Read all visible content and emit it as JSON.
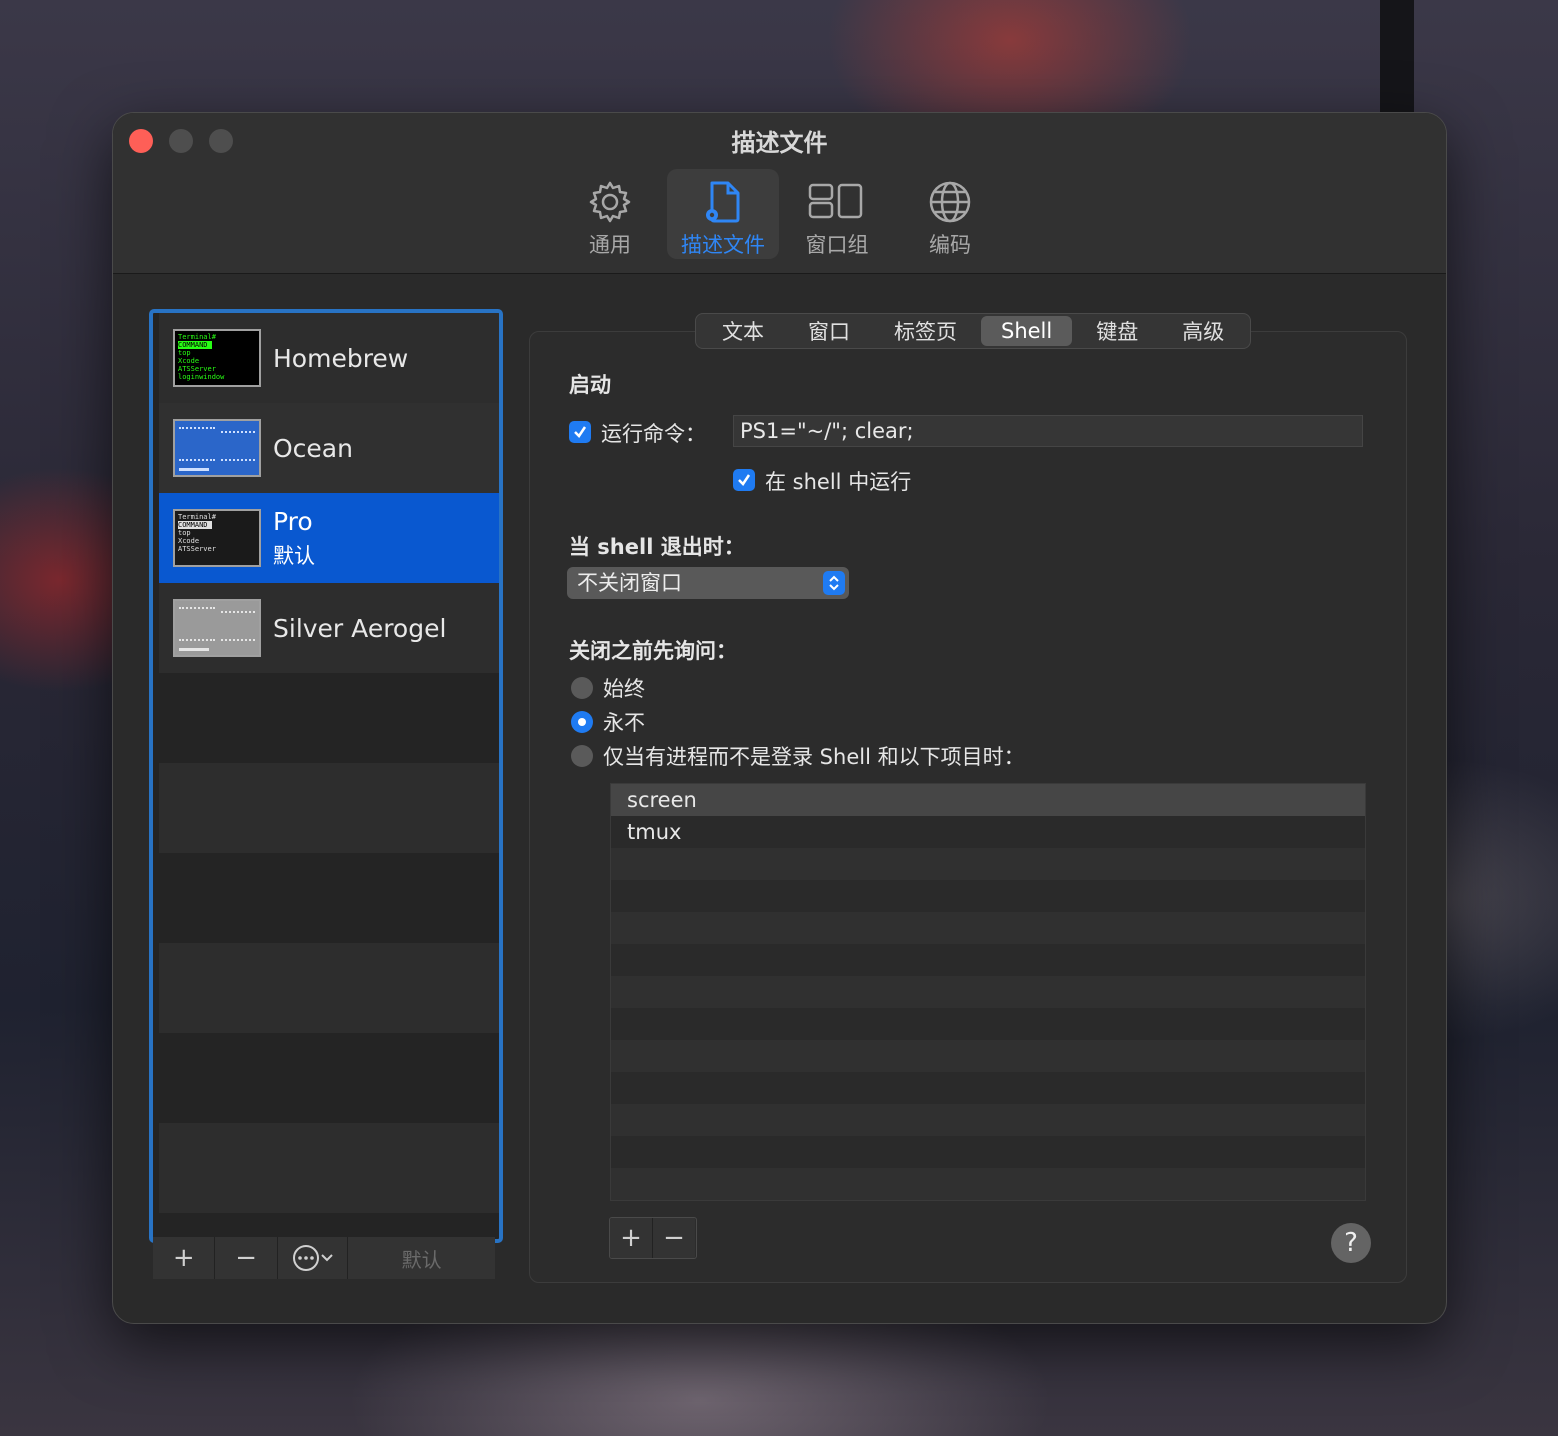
{
  "window": {
    "title": "描述文件"
  },
  "toolbar": {
    "items": [
      {
        "label": "通用",
        "icon": "gear-icon"
      },
      {
        "label": "描述文件",
        "icon": "profile-document-icon",
        "active": true
      },
      {
        "label": "窗口组",
        "icon": "window-group-icon"
      },
      {
        "label": "编码",
        "icon": "globe-icon"
      }
    ]
  },
  "sidebar": {
    "profiles": [
      {
        "name": "Homebrew",
        "theme": "homebrew"
      },
      {
        "name": "Ocean",
        "theme": "ocean"
      },
      {
        "name": "Pro",
        "default_tag": "默认",
        "selected": true,
        "theme": "pro"
      },
      {
        "name": "Silver Aerogel",
        "theme": "silver"
      }
    ],
    "thumb_text": {
      "homebrew": [
        "Terminal#",
        "COMMAND",
        "top",
        "Xcode",
        "ATSServer",
        "loginwindow"
      ],
      "pro": [
        "Terminal#",
        "COMMAND",
        "top",
        "Xcode",
        "ATSServer"
      ]
    },
    "buttons": {
      "add": "+",
      "remove": "−",
      "default": "默认"
    }
  },
  "tabs": [
    {
      "label": "文本"
    },
    {
      "label": "窗口"
    },
    {
      "label": "标签页"
    },
    {
      "label": "Shell",
      "active": true
    },
    {
      "label": "键盘"
    },
    {
      "label": "高级"
    }
  ],
  "shell": {
    "startup_heading": "启动",
    "run_command_label": "运行命令：",
    "run_command_checked": true,
    "run_command_value": "PS1=\"~/\"; clear;",
    "run_in_shell_label": "在 shell 中运行",
    "run_in_shell_checked": true,
    "on_exit_heading": "当 shell 退出时：",
    "on_exit_value": "不关闭窗口",
    "ask_heading": "关闭之前先询问：",
    "ask_options": [
      {
        "label": "始终",
        "selected": false
      },
      {
        "label": "永不",
        "selected": true
      },
      {
        "label": "仅当有进程而不是登录 Shell 和以下项目时：",
        "selected": false
      }
    ],
    "process_list": [
      "screen",
      "tmux"
    ],
    "list_add": "+",
    "list_remove": "−",
    "help": "?"
  },
  "colors": {
    "accent": "#1f7bf2",
    "selection": "#0958d0",
    "close": "#fe5f57"
  }
}
